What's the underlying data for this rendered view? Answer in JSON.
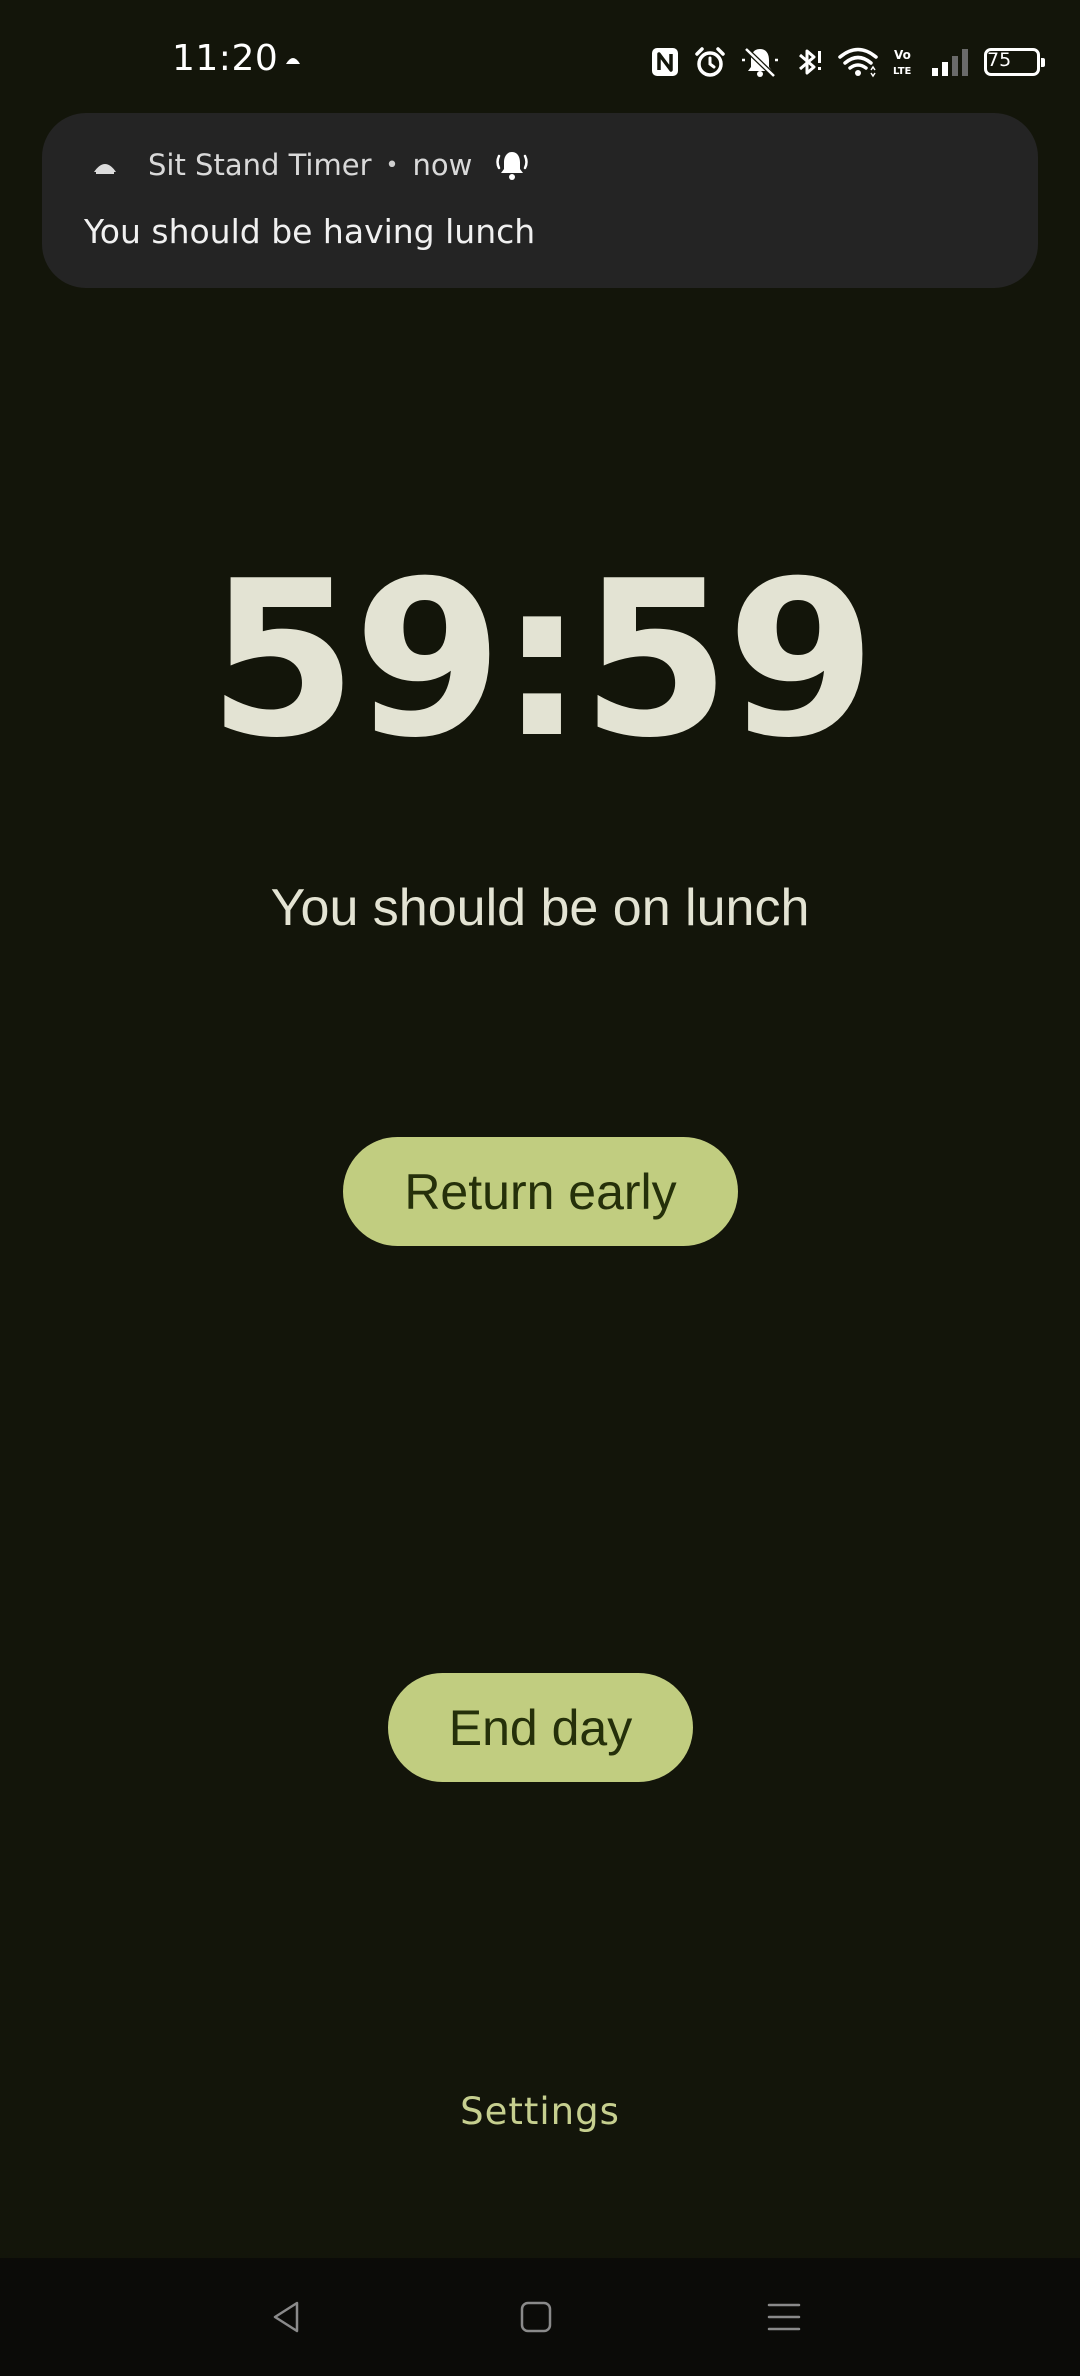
{
  "status_bar": {
    "time": "11:20",
    "battery_level": "75",
    "icons": [
      "app-notification-icon",
      "nfc-icon",
      "alarm-icon",
      "silent-bell-icon",
      "bluetooth-icon",
      "wifi-icon",
      "volte-icon",
      "signal-icon",
      "battery-icon"
    ]
  },
  "notification": {
    "app_name": "Sit Stand Timer",
    "separator": "•",
    "time": "now",
    "message": "You should be having lunch",
    "icons": [
      "app-icon",
      "alert-bell-icon"
    ]
  },
  "main": {
    "timer": "59:59",
    "status": "You should be on lunch",
    "return_early_label": "Return early",
    "end_day_label": "End day",
    "settings_label": "Settings"
  },
  "nav_bar": {
    "icons": [
      "back-icon",
      "home-icon",
      "recents-icon"
    ]
  },
  "colors": {
    "background": "#13150a",
    "timer_text": "#e3e3d3",
    "button_fill": "#c1cd80",
    "button_text": "#25300a",
    "settings_text": "#c6cf8f",
    "notification_bg": "#242424"
  }
}
